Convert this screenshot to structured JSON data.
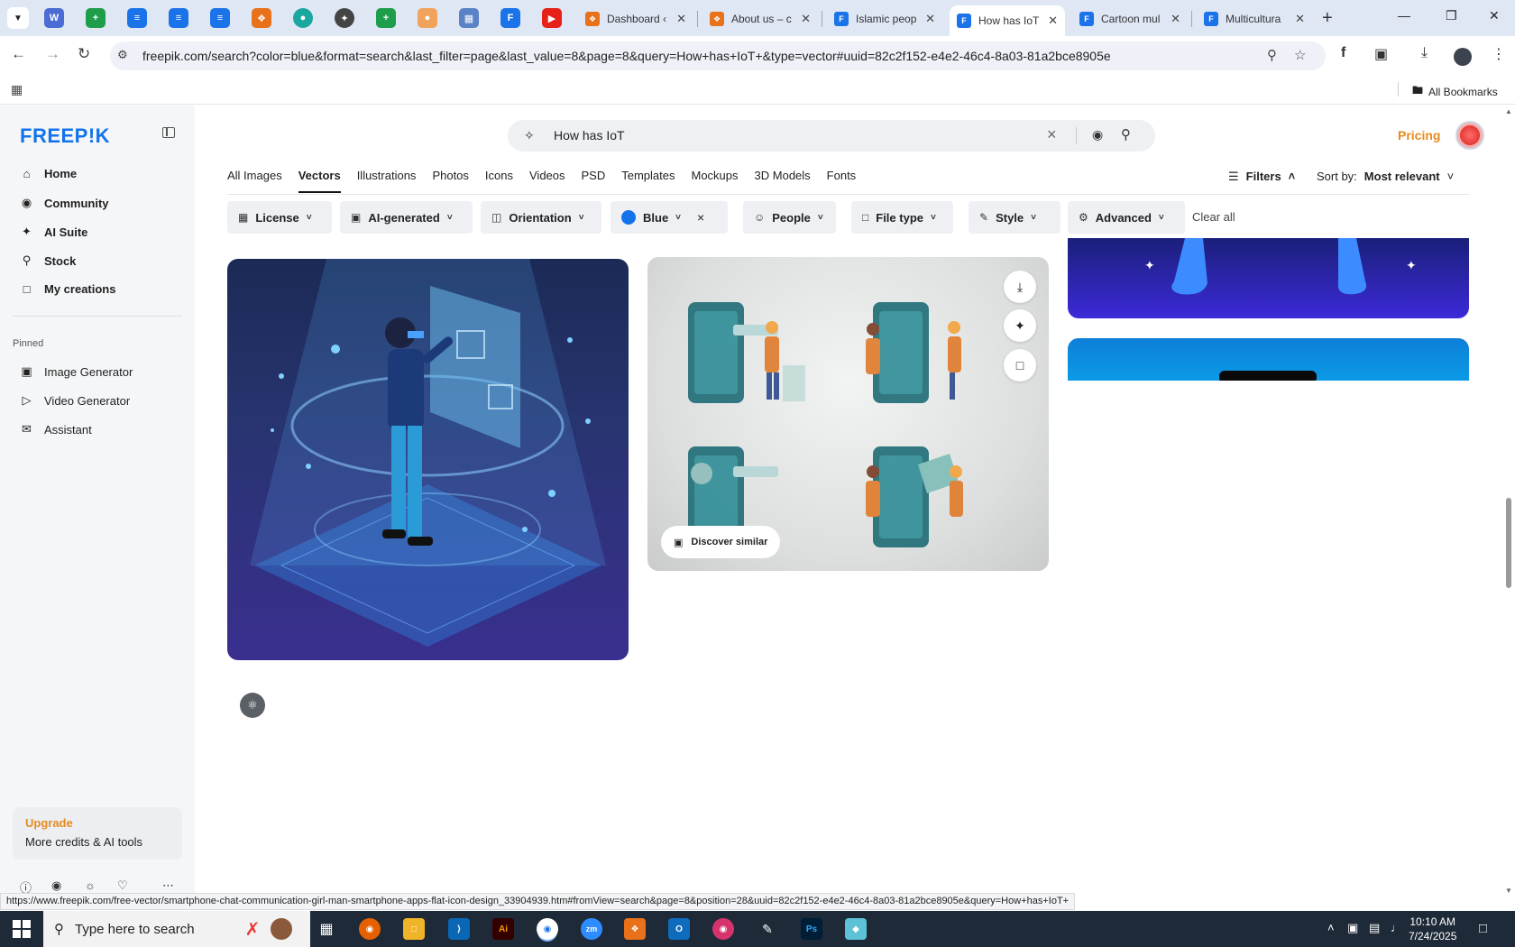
{
  "browser": {
    "tabs": [
      {
        "title": "Dashboard ‹",
        "color": "#e8711a"
      },
      {
        "title": "About us – c",
        "color": "#e8711a"
      },
      {
        "title": "Islamic peop",
        "color": "#1a73e8"
      },
      {
        "title": "How has IoT",
        "color": "#1a73e8"
      },
      {
        "title": "Cartoon mul",
        "color": "#1a73e8"
      },
      {
        "title": "Multicultura",
        "color": "#1a73e8"
      }
    ],
    "url": "freepik.com/search?color=blue&format=search&last_filter=page&last_value=8&page=8&query=How+has+IoT+&type=vector#uuid=82c2f152-e4e2-46c4-8a03-81a2bce8905e",
    "bookmarks_all": "All Bookmarks"
  },
  "sidebar": {
    "logo": "FREEP!K",
    "nav": [
      {
        "label": "Home",
        "icon": "home-icon"
      },
      {
        "label": "Community",
        "icon": "globe-icon"
      },
      {
        "label": "AI Suite",
        "icon": "sparkle-icon"
      },
      {
        "label": "Stock",
        "icon": "search-icon"
      },
      {
        "label": "My creations",
        "icon": "folder-icon"
      }
    ],
    "pinned_label": "Pinned",
    "pinned": [
      {
        "label": "Image Generator",
        "icon": "image-icon"
      },
      {
        "label": "Video Generator",
        "icon": "video-icon"
      },
      {
        "label": "Assistant",
        "icon": "chat-icon"
      }
    ],
    "upgrade": {
      "title": "Upgrade",
      "subtitle": "More credits & AI tools"
    }
  },
  "header": {
    "search_value": "How has IoT",
    "pricing": "Pricing",
    "type_tabs": [
      "All Images",
      "Vectors",
      "Illustrations",
      "Photos",
      "Icons",
      "Videos",
      "PSD",
      "Templates",
      "Mockups",
      "3D Models",
      "Fonts"
    ],
    "active_tab": "Vectors",
    "filters_label": "Filters",
    "sort_label": "Sort by:",
    "sort_value": "Most relevant"
  },
  "filter_chips": {
    "license": "License",
    "ai_generated": "AI-generated",
    "orientation": "Orientation",
    "color": "Blue",
    "color_hex": "#1273eb",
    "people": "People",
    "file_type": "File type",
    "style": "Style",
    "advanced": "Advanced",
    "clear_all": "Clear all"
  },
  "results": {
    "discover_similar": "Discover similar"
  },
  "status_bar_url": "https://www.freepik.com/free-vector/smartphone-chat-communication-girl-man-smartphone-apps-flat-icon-design_33904939.htm#fromView=search&page=8&position=28&uuid=82c2f152-e4e2-46c4-8a03-81a2bce8905e&query=How+has+IoT+",
  "taskbar": {
    "search_placeholder": "Type here to search",
    "time": "10:10 AM",
    "date": "7/24/2025"
  }
}
